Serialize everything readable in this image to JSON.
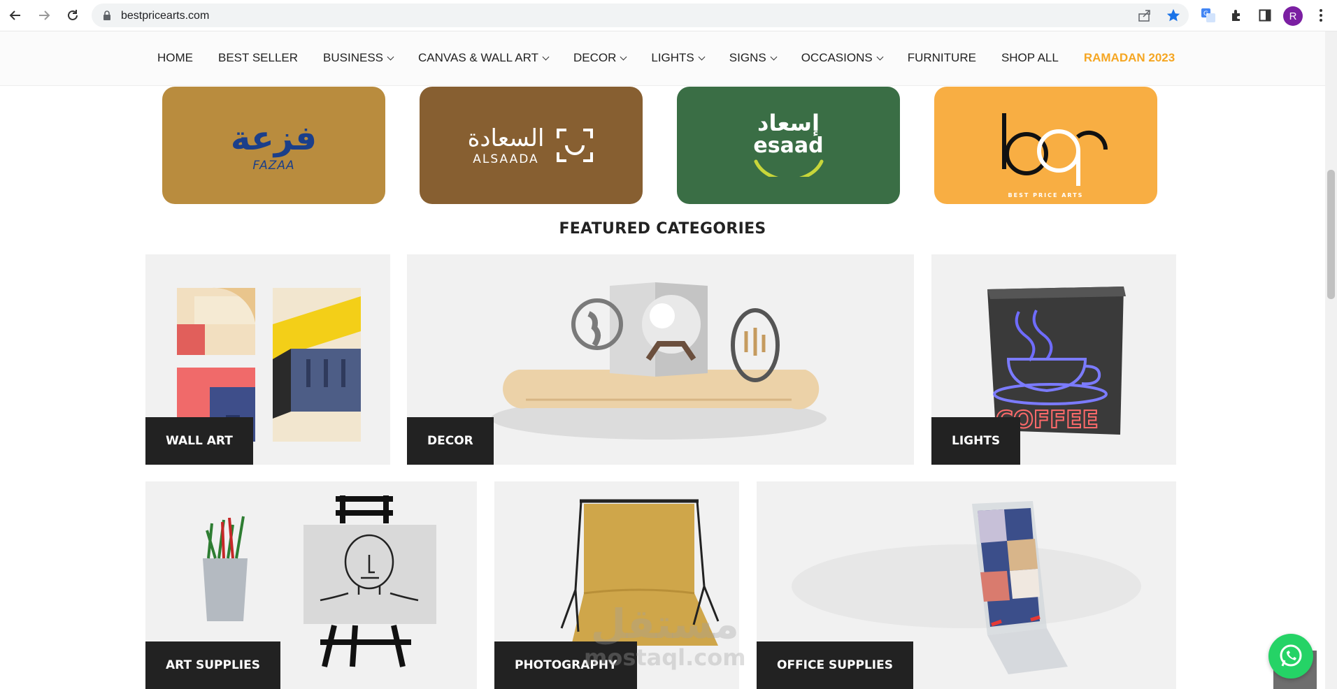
{
  "browser": {
    "url": "bestpricearts.com",
    "avatar_letter": "R"
  },
  "nav": {
    "items": [
      {
        "label": "HOME",
        "dropdown": false
      },
      {
        "label": "BEST SELLER",
        "dropdown": false
      },
      {
        "label": "BUSINESS",
        "dropdown": true
      },
      {
        "label": "CANVAS & WALL ART",
        "dropdown": true
      },
      {
        "label": "DECOR",
        "dropdown": true
      },
      {
        "label": "LIGHTS",
        "dropdown": true
      },
      {
        "label": "SIGNS",
        "dropdown": true
      },
      {
        "label": "OCCASIONS",
        "dropdown": true
      },
      {
        "label": "FURNITURE",
        "dropdown": false
      },
      {
        "label": "SHOP ALL",
        "dropdown": false
      },
      {
        "label": "RAMADAN 2023",
        "dropdown": false
      }
    ]
  },
  "partners": {
    "fazaa": {
      "latin": "FAZAA",
      "arabic": "فزعة",
      "color": "#b98c3e"
    },
    "alsaada": {
      "latin": "ALSAADA",
      "arabic": "السعادة",
      "color": "#875f31"
    },
    "esaad": {
      "latin": "esaad",
      "arabic": "إسعاد",
      "color": "#3a6e45"
    },
    "bpa": {
      "latin": "BEST PRICE ARTS",
      "color": "#f8ae43"
    }
  },
  "section": {
    "title": "FEATURED CATEGORIES"
  },
  "categories": {
    "wall_art": "WALL ART",
    "decor": "DECOR",
    "lights": "LIGHTS",
    "art_supplies": "ART SUPPLIES",
    "photography": "PHOTOGRAPHY",
    "office_supplies": "OFFICE SUPPLIES"
  },
  "lights_tile_sign": "COFFEE",
  "watermark": {
    "arabic": "مستقل",
    "latin": "mostaql.com"
  }
}
